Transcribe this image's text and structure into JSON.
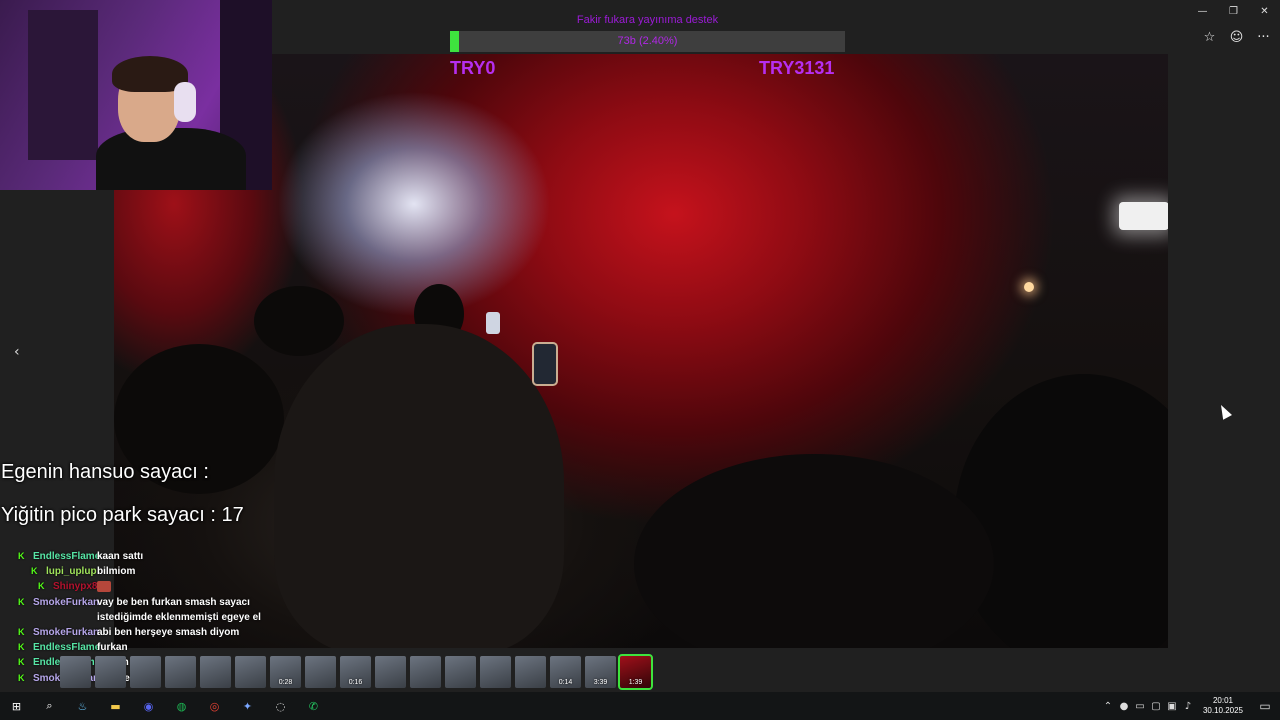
{
  "window": {
    "minimize_glyph": "—",
    "restore_glyph": "❐",
    "close_glyph": "✕"
  },
  "toolbar": {
    "favorite_glyph": "☆",
    "emoji_glyph": "☺",
    "more_glyph": "···"
  },
  "goal": {
    "title": "Fakir fukara yayınıma destek",
    "progress_text": "73b (2.40%)",
    "progress_percent": 2.4,
    "try_left": "TRY0",
    "try_right": "TRY3131",
    "fill_color": "#3ee33e",
    "text_color": "#b027e6"
  },
  "counters": {
    "hansuo": "Egenin hansuo sayacı :",
    "pico_park": "Yiğitin pico park sayacı : 17"
  },
  "chat": {
    "badge": "K",
    "messages": [
      {
        "user": "EndlessFlame",
        "color": "#57e6a6",
        "text": "kaan sattı",
        "badge": true
      },
      {
        "user": "lupi_uplup",
        "color": "#9fe35b",
        "text": "bilmiom",
        "badge": true
      },
      {
        "user": "Shinypx8",
        "color": "#b3122e",
        "text": "",
        "badge": true,
        "emote": true
      },
      {
        "user": "SmokeFurkan",
        "color": "#b6a6ea",
        "text": "vay be ben furkan smash sayacı",
        "badge": true
      },
      {
        "user": "",
        "color": "#ffffff",
        "text": "istediğimde eklenmemişti egeye el",
        "badge": false
      },
      {
        "user": "SmokeFurkan",
        "color": "#b6a6ea",
        "text": "abi ben herşeye smash diyom",
        "badge": true
      },
      {
        "user": "EndlessFlame",
        "color": "#57e6a6",
        "text": "furkan",
        "badge": true
      },
      {
        "user": "EndlessFlame",
        "color": "#57e6a6",
        "text": "smash mi",
        "badge": true
      },
      {
        "user": "SmokeFurkan",
        "color": "#b6a6ea",
        "text": "geri geldim",
        "badge": true
      }
    ]
  },
  "thumbnails": [
    {
      "duration": ""
    },
    {
      "duration": ""
    },
    {
      "duration": ""
    },
    {
      "duration": ""
    },
    {
      "duration": ""
    },
    {
      "duration": ""
    },
    {
      "duration": "0:28"
    },
    {
      "duration": ""
    },
    {
      "duration": "0:16"
    },
    {
      "duration": ""
    },
    {
      "duration": ""
    },
    {
      "duration": ""
    },
    {
      "duration": ""
    },
    {
      "duration": ""
    },
    {
      "duration": "0:14"
    },
    {
      "duration": "3:39"
    },
    {
      "duration": "1:39"
    }
  ],
  "nav": {
    "prev_glyph": "‹"
  },
  "taskbar": {
    "apps": [
      {
        "name": "start",
        "glyph": "⊞",
        "color": "#ffffff"
      },
      {
        "name": "search",
        "glyph": "⌕",
        "color": "#ffffff"
      },
      {
        "name": "steam",
        "glyph": "♨",
        "color": "#66c0f4"
      },
      {
        "name": "explorer",
        "glyph": "▬",
        "color": "#f3c94b"
      },
      {
        "name": "discord",
        "glyph": "◉",
        "color": "#5865f2"
      },
      {
        "name": "spotify",
        "glyph": "◍",
        "color": "#1db954"
      },
      {
        "name": "chrome",
        "glyph": "◎",
        "color": "#ea4335"
      },
      {
        "name": "app",
        "glyph": "✦",
        "color": "#7aa7ff"
      },
      {
        "name": "obs",
        "glyph": "◌",
        "color": "#dddddd"
      },
      {
        "name": "whatsapp",
        "glyph": "✆",
        "color": "#25d366"
      }
    ],
    "tray": {
      "chevron_glyph": "⌃",
      "mic_glyph": "●",
      "display_glyph": "▭",
      "monitor_glyph": "▢",
      "network_glyph": "▣",
      "volume_glyph": "♪",
      "time": "20:01",
      "date": "30.10.2025",
      "notification_glyph": "▭"
    }
  }
}
